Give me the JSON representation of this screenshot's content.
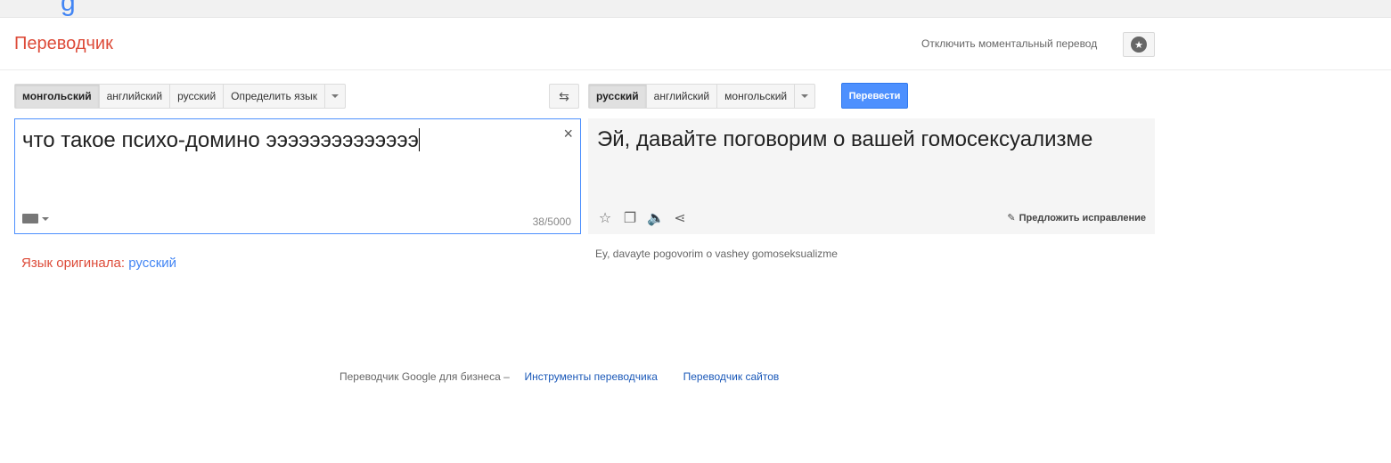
{
  "topbar": {
    "logo_fragment": "g"
  },
  "header": {
    "app_title": "Переводчик",
    "instant_off_label": "Отключить моментальный перевод",
    "star_icon": "star-icon"
  },
  "source": {
    "languages": [
      {
        "label": "монгольский",
        "active": true
      },
      {
        "label": "английский",
        "active": false
      },
      {
        "label": "русский",
        "active": false
      },
      {
        "label": "Определить язык",
        "active": false
      }
    ],
    "text": "что такое психо-домино ээээээээээээээ",
    "char_count": "38/5000",
    "clear_icon": "×",
    "detected_label": "Язык оригинала:",
    "detected_value": "русский"
  },
  "swap_icon": "⇆",
  "target": {
    "languages": [
      {
        "label": "русский",
        "active": true
      },
      {
        "label": "английский",
        "active": false
      },
      {
        "label": "монгольский",
        "active": false
      }
    ],
    "translate_button": "Перевести",
    "text": "Эй, давайте поговорим о вашей гомосексуализме",
    "transliteration": "Ey, davayte pogovorim o vashey gomoseksualizme",
    "suggest_label": "Предложить исправление",
    "tools": {
      "star": "☆",
      "copy": "❐",
      "speaker": "🔈",
      "share": "⋖"
    }
  },
  "footer": {
    "prefix": "Переводчик Google для бизнеса –",
    "link_tools": "Инструменты переводчика",
    "link_sites": "Переводчик сайтов"
  },
  "colors": {
    "accent_red": "#dd4b39",
    "accent_blue": "#4d90fe",
    "link_blue": "#1a58b8"
  }
}
